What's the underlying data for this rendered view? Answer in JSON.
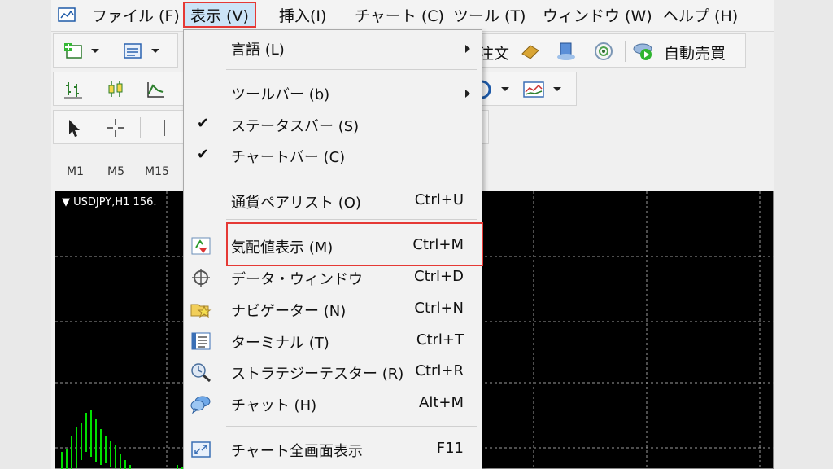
{
  "menubar": {
    "items": [
      {
        "label": "ファイル (F)"
      },
      {
        "label": "表示 (V)"
      },
      {
        "label": "挿入(I)"
      },
      {
        "label": "チャート (C)"
      },
      {
        "label": "ツール (T)"
      },
      {
        "label": "ウィンドウ (W)"
      },
      {
        "label": "ヘルプ (H)"
      }
    ]
  },
  "toolbar": {
    "order_label": "注文",
    "auto_trade_label": "自動売買",
    "timeframes": [
      "M1",
      "M5",
      "M15"
    ]
  },
  "chart": {
    "title": "USDJPY,H1  156."
  },
  "view_menu": {
    "items": [
      {
        "label": "言語 (L)",
        "shortcut": "",
        "submenu": true
      },
      {
        "label": "ツールバー (b)",
        "shortcut": "",
        "submenu": true
      },
      {
        "label": "ステータスバー (S)",
        "shortcut": "",
        "checked": true
      },
      {
        "label": "チャートバー (C)",
        "shortcut": "",
        "checked": true
      },
      {
        "label": "通貨ペアリスト (O)",
        "shortcut": "Ctrl+U"
      },
      {
        "label": "気配値表示 (M)",
        "shortcut": "Ctrl+M",
        "icon": "market-watch-icon"
      },
      {
        "label": "データ・ウィンドウ",
        "shortcut": "Ctrl+D",
        "icon": "crosshair-icon"
      },
      {
        "label": "ナビゲーター (N)",
        "shortcut": "Ctrl+N",
        "icon": "navigator-icon"
      },
      {
        "label": "ターミナル (T)",
        "shortcut": "Ctrl+T",
        "icon": "terminal-icon"
      },
      {
        "label": "ストラテジーテスター (R)",
        "shortcut": "Ctrl+R",
        "icon": "tester-icon"
      },
      {
        "label": "チャット (H)",
        "shortcut": "Alt+M",
        "icon": "chat-icon"
      },
      {
        "label": "チャート全画面表示",
        "shortcut": "F11",
        "icon": "fullscreen-icon"
      }
    ],
    "check_glyph": "✔"
  },
  "colors": {
    "highlight": "#e53935",
    "chart_background": "#000000",
    "chart_grid": "#9a9a9a",
    "candle_green": "#00e000"
  }
}
